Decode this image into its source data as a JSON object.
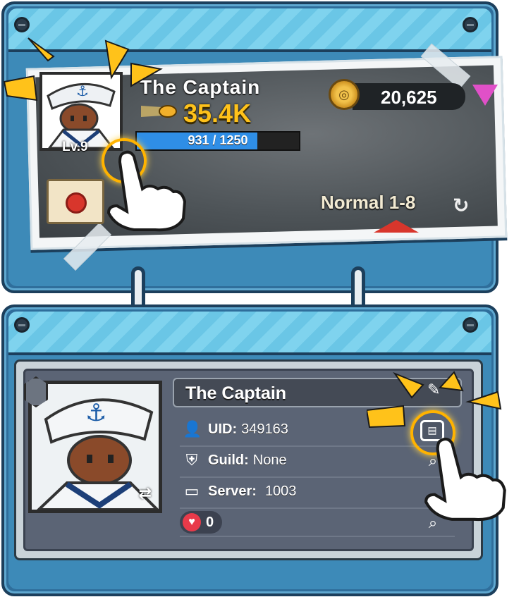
{
  "top_panel": {
    "player_name": "The Captain",
    "power": "35.4K",
    "xp_text": "931 / 1250",
    "xp_current": 931,
    "xp_max": 1250,
    "level": "Lv.9",
    "gold": "20,625",
    "stage": "Normal 1-8"
  },
  "profile_panel": {
    "player_name": "The Captain",
    "uid_label": "UID:",
    "uid_value": "349163",
    "guild_label": "Guild:",
    "guild_value": "None",
    "server_label": "Server:",
    "server_value": "1003",
    "likes": "0"
  },
  "icons": {
    "power": "bullet-icon",
    "gold": "gold-coin-icon",
    "gem": "gem-icon",
    "stage_refresh": "refresh-icon",
    "mail": "mail-envelope-icon",
    "uid": "user-icon",
    "guild": "guild-shield-icon",
    "server": "monitor-icon",
    "likes": "heart-icon",
    "edit": "pencil-icon",
    "copy": "copy-icon",
    "search": "magnifier-icon",
    "tutorial_pointer": "pointing-hand-icon"
  },
  "colors": {
    "board": "#2f6e9b",
    "power_text": "#ffc21a",
    "xp_bar": "#2f8ee6",
    "highlight": "#ffb300",
    "heart": "#e83a4a"
  }
}
